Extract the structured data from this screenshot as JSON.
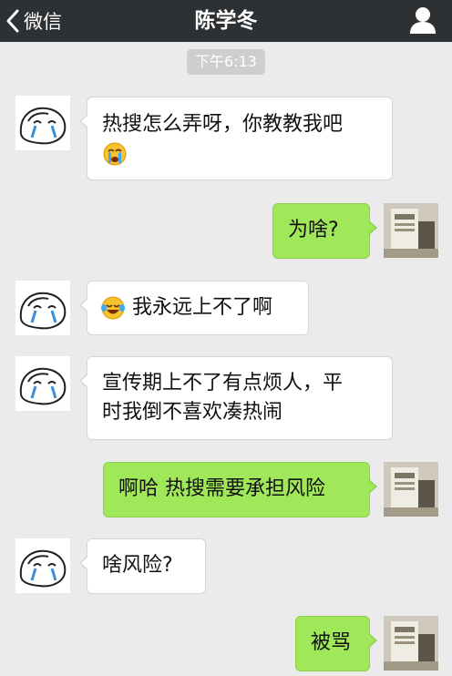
{
  "nav": {
    "back_label": "微信",
    "title": "陈学冬",
    "back_icon": "chevron-left-icon",
    "profile_icon": "person-icon"
  },
  "time_label": "下午6:13",
  "messages": [
    {
      "side": "left",
      "text": "热搜怎么弄呀，你教教我吧",
      "emoji": "crying-face-emoji"
    },
    {
      "side": "right",
      "text": "为啥?"
    },
    {
      "side": "left",
      "emoji": "tears-of-joy-emoji",
      "text": "我永远上不了啊"
    },
    {
      "side": "left",
      "line1": "宣传期上不了有点烦人，平",
      "line2": "时我倒不喜欢凑热闹"
    },
    {
      "side": "right",
      "text": "啊哈 热搜需要承担风险"
    },
    {
      "side": "left",
      "text": "啥风险?"
    },
    {
      "side": "right",
      "text": "被骂"
    }
  ],
  "colors": {
    "nav_bg": "#2e3133",
    "chat_bg": "#ebebeb",
    "sent_bubble": "#a0e75a",
    "received_bubble": "#ffffff",
    "time_badge": "#cecece"
  }
}
